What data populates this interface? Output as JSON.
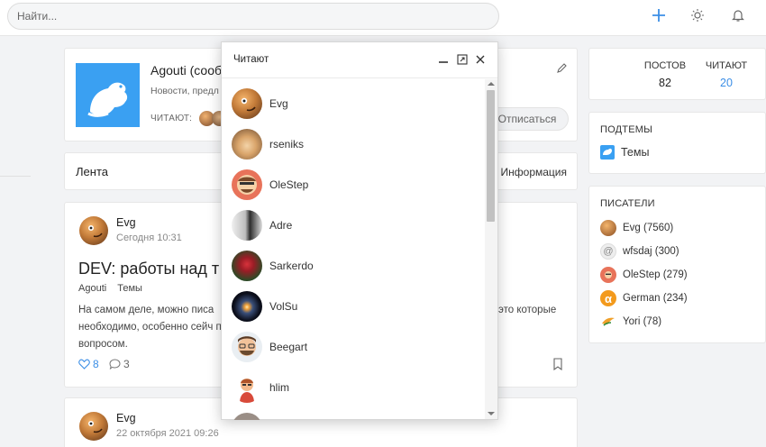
{
  "search": {
    "placeholder": "Найти..."
  },
  "topbar": {
    "add_icon": "plus-icon",
    "theme_icon": "sun-icon",
    "notify_icon": "bell-icon"
  },
  "blog": {
    "title": "Agouti (сооб",
    "description": "Новости, предл",
    "readers_label": "ЧИТАЮТ:",
    "unsubscribe_label": "Отписаться"
  },
  "tabs": {
    "feed": "Лента",
    "info": "Информация"
  },
  "posts": [
    {
      "author": "Evg",
      "date": "Сегодня 10:31",
      "title": "DEV: работы над т",
      "tags": [
        "Agouti",
        "Темы"
      ],
      "text_left": "На самом деле, можно писа необходимо, особенно сейч под вопросом.",
      "text_right": "это которые",
      "likes": "8",
      "comments": "3"
    },
    {
      "author": "Evg",
      "date": "22 октября 2021 09:26"
    }
  ],
  "stats": {
    "posts_label": "ПОСТОВ",
    "posts_value": "82",
    "readers_label": "ЧИТАЮТ",
    "readers_value": "20"
  },
  "subtopics": {
    "heading": "ПОДТЕМЫ",
    "item": "Темы"
  },
  "writers": {
    "heading": "ПИСАТЕЛИ",
    "items": [
      "Evg (7560)",
      "wfsdaj (300)",
      "OleStep (279)",
      "German (234)",
      "Yori (78)"
    ]
  },
  "modal": {
    "title": "Читают",
    "readers": [
      "Evg",
      "rseniks",
      "OleStep",
      "Adre",
      "Sarkerdo",
      "VolSu",
      "Beegart",
      "hlim"
    ]
  },
  "colors": {
    "accent": "#3b8ee6",
    "brand": "#3aa0f2",
    "readers_count": "#3b8ee6"
  }
}
